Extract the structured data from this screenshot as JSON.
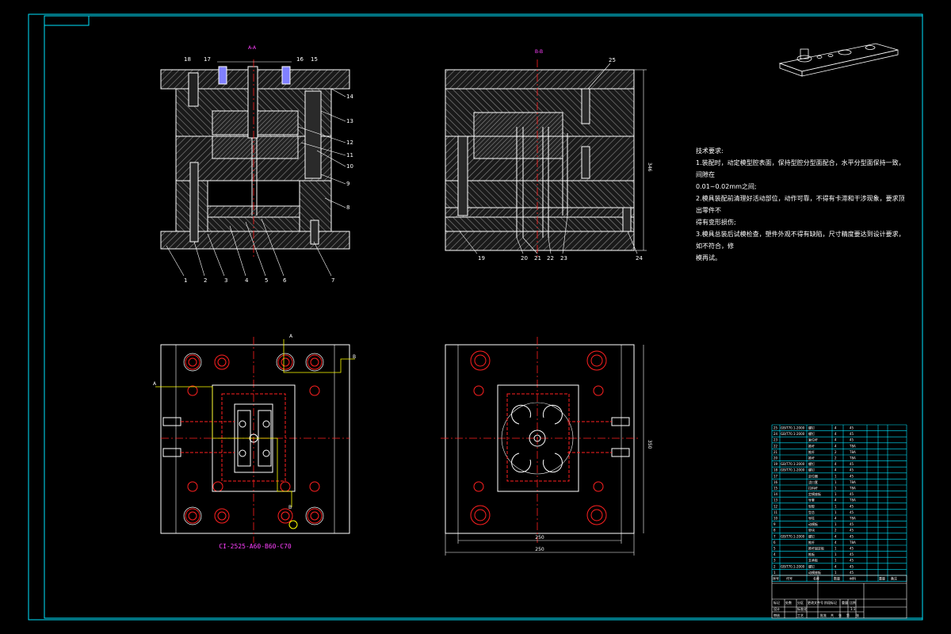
{
  "title_block_top_left": "",
  "front_section": {
    "title": "A-A",
    "subtitle": "B-B",
    "top_note": "A",
    "part_callouts_top": [
      "18",
      "17",
      "16",
      "15"
    ],
    "part_callouts_right": [
      "14",
      "13",
      "12",
      "11",
      "10",
      "9",
      "8"
    ],
    "part_callouts_bottom": [
      "1",
      "2",
      "3",
      "4",
      "5",
      "6",
      "7"
    ]
  },
  "side_section": {
    "title": "B-B",
    "part_callouts_top": [
      "25"
    ],
    "part_callouts_bottom": [
      "19",
      "20",
      "21",
      "22",
      "23",
      "24"
    ],
    "height_dim": "346"
  },
  "plan_view_left": {
    "model_code": "CI-2525-A60-B60-C70",
    "section_marks": [
      "A",
      "A",
      "B",
      "B"
    ]
  },
  "plan_view_right": {
    "dim_inner": "250",
    "dim_outer": "250",
    "dim_height": "350"
  },
  "technical_requirements": {
    "heading": "技术要求:",
    "lines": [
      "1.装配时，动定模型腔表面，保持型腔分型面配合，水平分型面保持一致，间隙在",
      "0.01~0.02mm之间;",
      "2.模具装配前清理好活动部位，动作可靠，不得有卡滞和干涉现象，要求顶出零件不",
      "得有变形损伤;",
      "3.模具总装后试模检查，塑件外观不得有缺陷，尺寸精度要达到设计要求，如不符合，修",
      "模再试。"
    ]
  },
  "bom": {
    "rows": [
      {
        "no": "25",
        "code": "GB/T70.1-2000",
        "name": "螺钉",
        "qty": "4",
        "mat": "45"
      },
      {
        "no": "24",
        "code": "GB/T70.1-2000",
        "name": "螺钉",
        "qty": "4",
        "mat": "45"
      },
      {
        "no": "23",
        "code": "",
        "name": "复位杆",
        "qty": "4",
        "mat": "45"
      },
      {
        "no": "22",
        "code": "",
        "name": "推杆",
        "qty": "4",
        "mat": "T8A"
      },
      {
        "no": "21",
        "code": "",
        "name": "推杆",
        "qty": "2",
        "mat": "T8A"
      },
      {
        "no": "20",
        "code": "",
        "name": "推杆",
        "qty": "2",
        "mat": "T8A"
      },
      {
        "no": "19",
        "code": "GB/T70.1-2000",
        "name": "螺钉",
        "qty": "4",
        "mat": "45"
      },
      {
        "no": "18",
        "code": "GB/T70.1-2000",
        "name": "螺钉",
        "qty": "4",
        "mat": "45"
      },
      {
        "no": "17",
        "code": "",
        "name": "定位圈",
        "qty": "1",
        "mat": "45"
      },
      {
        "no": "16",
        "code": "",
        "name": "浇口套",
        "qty": "1",
        "mat": "T8A"
      },
      {
        "no": "15",
        "code": "",
        "name": "拉料杆",
        "qty": "1",
        "mat": "T8A"
      },
      {
        "no": "14",
        "code": "",
        "name": "定模座板",
        "qty": "1",
        "mat": "45"
      },
      {
        "no": "13",
        "code": "",
        "name": "导套",
        "qty": "4",
        "mat": "T8A"
      },
      {
        "no": "12",
        "code": "",
        "name": "型腔",
        "qty": "1",
        "mat": "45"
      },
      {
        "no": "11",
        "code": "",
        "name": "型芯",
        "qty": "1",
        "mat": "45"
      },
      {
        "no": "10",
        "code": "",
        "name": "导柱",
        "qty": "4",
        "mat": "T8A"
      },
      {
        "no": "9",
        "code": "",
        "name": "动模板",
        "qty": "1",
        "mat": "45"
      },
      {
        "no": "8",
        "code": "",
        "name": "垫块",
        "qty": "2",
        "mat": "45"
      },
      {
        "no": "7",
        "code": "GB/T70.1-2000",
        "name": "螺钉",
        "qty": "4",
        "mat": "45"
      },
      {
        "no": "6",
        "code": "",
        "name": "推杆",
        "qty": "4",
        "mat": "T8A"
      },
      {
        "no": "5",
        "code": "",
        "name": "推杆固定板",
        "qty": "1",
        "mat": "45"
      },
      {
        "no": "4",
        "code": "",
        "name": "推板",
        "qty": "1",
        "mat": "45"
      },
      {
        "no": "3",
        "code": "",
        "name": "支承板",
        "qty": "1",
        "mat": "45"
      },
      {
        "no": "2",
        "code": "GB/T70.1-2000",
        "name": "螺钉",
        "qty": "4",
        "mat": "45"
      },
      {
        "no": "1",
        "code": "",
        "name": "动模座板",
        "qty": "1",
        "mat": "45"
      }
    ],
    "header": [
      "序号",
      "代号",
      "名称",
      "数量",
      "材料",
      "重量",
      "备注"
    ]
  },
  "title_block": {
    "cells": [
      "标记",
      "处数",
      "分区",
      "更改文件号",
      "签名",
      "日期",
      "设计",
      "标准化",
      "阶段标记",
      "重量",
      "比例",
      "审核",
      "工艺",
      "批准",
      "共",
      "张",
      "第",
      "张"
    ],
    "scale": "1:1"
  },
  "colors": {
    "background": "#000000",
    "line": "#ffffff",
    "hatch": "#8c8c8c",
    "center_line": "#ff2020",
    "cyan": "#00e5ff",
    "magenta": "#ff40ff",
    "yellow": "#ffff00"
  }
}
